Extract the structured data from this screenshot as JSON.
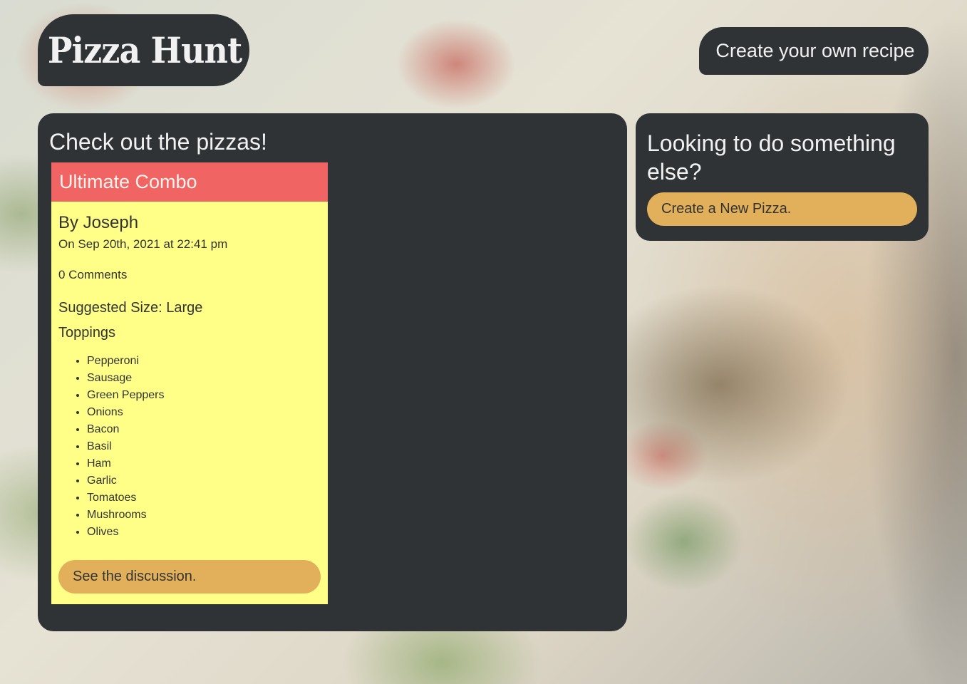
{
  "header": {
    "logo_text": "Pizza Hunt",
    "create_recipe_label": "Create your own recipe"
  },
  "main": {
    "heading": "Check out the pizzas!",
    "pizzas": [
      {
        "name": "Ultimate Combo",
        "author": "By Joseph",
        "date": "On Sep 20th, 2021 at 22:41 pm",
        "comments": "0 Comments",
        "size": "Suggested Size: Large",
        "toppings_title": "Toppings",
        "toppings": [
          "Pepperoni",
          "Sausage",
          "Green Peppers",
          "Onions",
          "Bacon",
          "Basil",
          "Ham",
          "Garlic",
          "Tomatoes",
          "Mushrooms",
          "Olives"
        ],
        "discussion_label": "See the discussion."
      }
    ]
  },
  "sidebar": {
    "heading": "Looking to do something else?",
    "new_pizza_label": "Create a New Pizza."
  },
  "colors": {
    "panel_bg": "#2f3336",
    "card_bg": "#ffff88",
    "card_header_bg": "#f06563",
    "button_bg": "#e2b05a"
  }
}
